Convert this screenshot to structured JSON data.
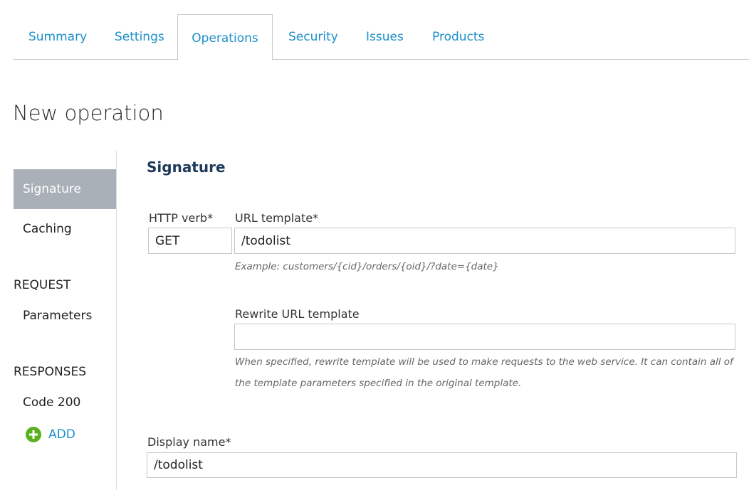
{
  "tabs": [
    {
      "label": "Summary"
    },
    {
      "label": "Settings"
    },
    {
      "label": "Operations"
    },
    {
      "label": "Security"
    },
    {
      "label": "Issues"
    },
    {
      "label": "Products"
    }
  ],
  "page_title": "New operation",
  "sidebar": {
    "signature": "Signature",
    "caching": "Caching",
    "request_heading": "REQUEST",
    "parameters": "Parameters",
    "responses_heading": "RESPONSES",
    "code_200": "Code 200",
    "add_label": "ADD"
  },
  "form": {
    "section_title": "Signature",
    "http_verb_label": "HTTP verb*",
    "http_verb_value": "GET",
    "url_template_label": "URL template*",
    "url_template_value": "/todolist",
    "url_example": "Example: customers/{cid}/orders/{oid}/?date={date}",
    "rewrite_label": "Rewrite URL template",
    "rewrite_value": "",
    "rewrite_help": "When specified, rewrite template will be used to make requests to the web service. It can contain all of the template parameters specified in the original template.",
    "display_name_label": "Display name*",
    "display_name_value": "/todolist"
  },
  "colors": {
    "accent": "#1c8fc9",
    "selected_nav_bg": "#a9b0b8",
    "section_title": "#1e3a5a",
    "add_icon": "#5ab11e"
  }
}
